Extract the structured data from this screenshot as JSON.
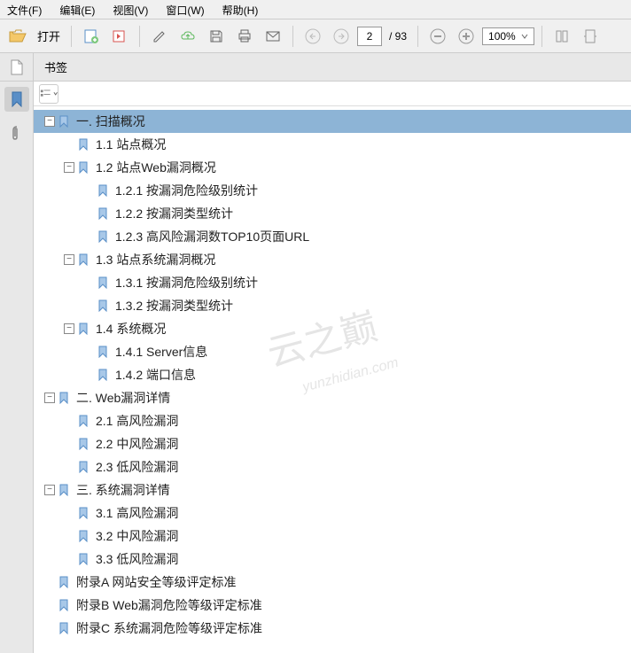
{
  "menu": {
    "file": "文件(F)",
    "edit": "编辑(E)",
    "view": "视图(V)",
    "window": "窗口(W)",
    "help": "帮助(H)"
  },
  "toolbar": {
    "open_label": "打开",
    "page_current": "2",
    "page_total": "/ 93",
    "zoom_value": "100%"
  },
  "tab": {
    "title": "书签"
  },
  "watermark": {
    "main": "云之巅",
    "sub": "yunzhidian.com"
  },
  "tree": [
    {
      "depth": 0,
      "toggle": "-",
      "label": "一. 扫描概况",
      "sel": true
    },
    {
      "depth": 1,
      "toggle": "",
      "label": "1.1 站点概况"
    },
    {
      "depth": 1,
      "toggle": "-",
      "label": "1.2 站点Web漏洞概况"
    },
    {
      "depth": 2,
      "toggle": "",
      "label": "1.2.1 按漏洞危险级别统计"
    },
    {
      "depth": 2,
      "toggle": "",
      "label": "1.2.2 按漏洞类型统计"
    },
    {
      "depth": 2,
      "toggle": "",
      "label": "1.2.3 高风险漏洞数TOP10页面URL"
    },
    {
      "depth": 1,
      "toggle": "-",
      "label": "1.3 站点系统漏洞概况"
    },
    {
      "depth": 2,
      "toggle": "",
      "label": "1.3.1 按漏洞危险级别统计"
    },
    {
      "depth": 2,
      "toggle": "",
      "label": "1.3.2 按漏洞类型统计"
    },
    {
      "depth": 1,
      "toggle": "-",
      "label": "1.4 系统概况"
    },
    {
      "depth": 2,
      "toggle": "",
      "label": "1.4.1 Server信息"
    },
    {
      "depth": 2,
      "toggle": "",
      "label": "1.4.2 端口信息"
    },
    {
      "depth": 0,
      "toggle": "-",
      "label": "二. Web漏洞详情"
    },
    {
      "depth": 1,
      "toggle": "",
      "label": "2.1 高风险漏洞"
    },
    {
      "depth": 1,
      "toggle": "",
      "label": "2.2 中风险漏洞"
    },
    {
      "depth": 1,
      "toggle": "",
      "label": "2.3 低风险漏洞"
    },
    {
      "depth": 0,
      "toggle": "-",
      "label": "三. 系统漏洞详情"
    },
    {
      "depth": 1,
      "toggle": "",
      "label": "3.1 高风险漏洞"
    },
    {
      "depth": 1,
      "toggle": "",
      "label": "3.2 中风险漏洞"
    },
    {
      "depth": 1,
      "toggle": "",
      "label": "3.3 低风险漏洞"
    },
    {
      "depth": 0,
      "toggle": "",
      "label": "附录A 网站安全等级评定标准"
    },
    {
      "depth": 0,
      "toggle": "",
      "label": "附录B Web漏洞危险等级评定标准"
    },
    {
      "depth": 0,
      "toggle": "",
      "label": "附录C 系统漏洞危险等级评定标准"
    }
  ]
}
